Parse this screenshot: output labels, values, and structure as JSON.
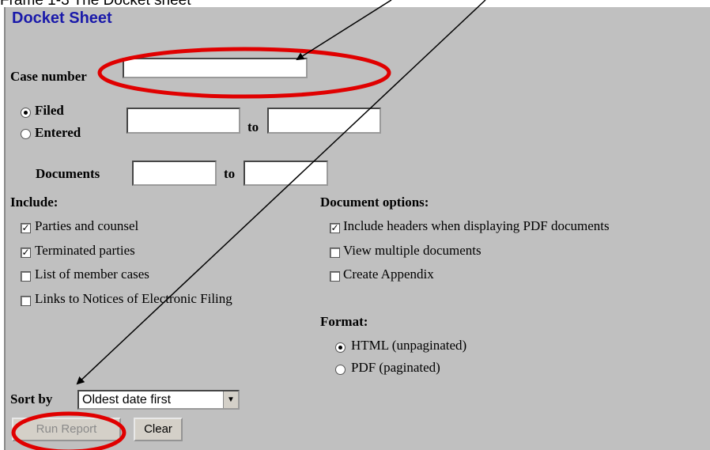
{
  "caption": "Frame 1-3 The Docket sheet",
  "title": "Docket Sheet",
  "case_number": {
    "label": "Case number",
    "value": ""
  },
  "date_filter": {
    "filed": "Filed",
    "entered": "Entered",
    "to": "to"
  },
  "documents": {
    "label": "Documents",
    "to": "to"
  },
  "include": {
    "heading": "Include:",
    "items": [
      {
        "label": "Parties and counsel",
        "checked": true
      },
      {
        "label": "Terminated parties",
        "checked": true
      },
      {
        "label": "List of member cases",
        "checked": false
      },
      {
        "label": "Links to Notices of Electronic Filing",
        "checked": false
      }
    ]
  },
  "document_options": {
    "heading": "Document options:",
    "items": [
      {
        "label": "Include headers when displaying PDF documents",
        "checked": true
      },
      {
        "label": "View multiple documents",
        "checked": false
      },
      {
        "label": "Create Appendix",
        "checked": false
      }
    ]
  },
  "format": {
    "heading": "Format:",
    "options": [
      {
        "label": "HTML (unpaginated)",
        "selected": true
      },
      {
        "label": "PDF (paginated)",
        "selected": false
      }
    ]
  },
  "sort": {
    "label": "Sort by",
    "value": "Oldest date first"
  },
  "buttons": {
    "run": "Run Report",
    "clear": "Clear"
  },
  "colors": {
    "panel": "#c0c0c0",
    "title": "#1a1aaa",
    "annotation": "#e00000"
  }
}
